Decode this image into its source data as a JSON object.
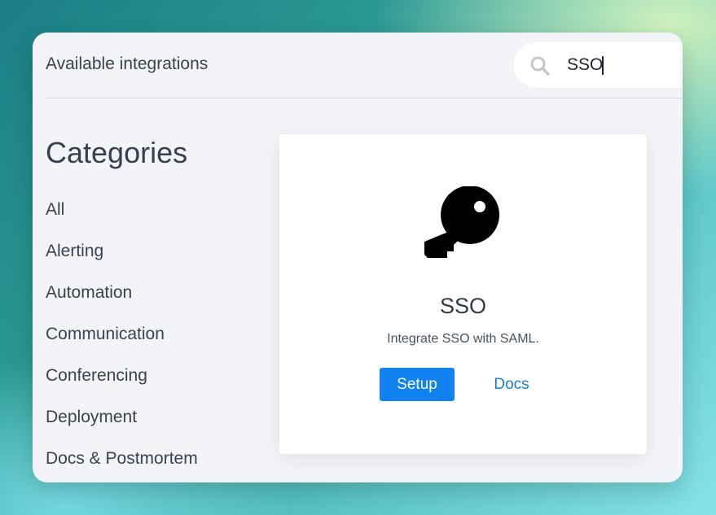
{
  "header": {
    "title": "Available integrations"
  },
  "search": {
    "value": "SSO",
    "icon": "search-icon"
  },
  "sidebar": {
    "heading": "Categories",
    "items": [
      {
        "label": "All"
      },
      {
        "label": "Alerting"
      },
      {
        "label": "Automation"
      },
      {
        "label": "Communication"
      },
      {
        "label": "Conferencing"
      },
      {
        "label": "Deployment"
      },
      {
        "label": "Docs & Postmortem"
      }
    ]
  },
  "integration_card": {
    "icon": "key-icon",
    "title": "SSO",
    "description": "Integrate SSO with SAML.",
    "setup_label": "Setup",
    "docs_label": "Docs"
  },
  "colors": {
    "accent": "#1182f0",
    "link": "#1a7fd1",
    "window_bg": "#f3f4f8",
    "text": "#3a4150"
  }
}
